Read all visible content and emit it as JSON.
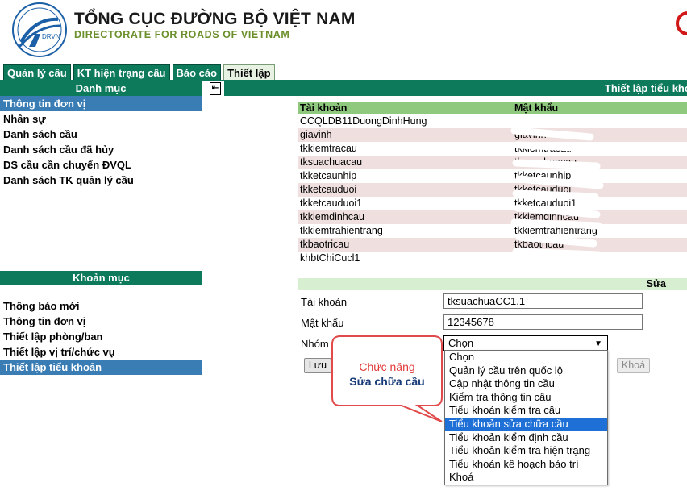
{
  "header": {
    "title_vi": "TỔNG CỤC ĐƯỜNG BỘ VIỆT NAM",
    "title_en": "DIRECTORATE FOR ROADS OF VIETNAM",
    "logo_text": "DRVN"
  },
  "tabs": [
    {
      "label": "Quản lý cầu",
      "active": false
    },
    {
      "label": "KT hiện trạng cầu",
      "active": false
    },
    {
      "label": "Báo cáo",
      "active": false
    },
    {
      "label": "Thiết lập",
      "active": true
    }
  ],
  "sidebar": {
    "section1": {
      "title": "Danh mục",
      "items": [
        {
          "label": "Thông tin đơn vị",
          "selected": true
        },
        {
          "label": "Nhân sự",
          "selected": false
        },
        {
          "label": "Danh sách cầu",
          "selected": false
        },
        {
          "label": "Danh sách cầu đã hủy",
          "selected": false
        },
        {
          "label": "DS cầu cần chuyển ĐVQL",
          "selected": false
        },
        {
          "label": "Danh sách TK quản lý cầu",
          "selected": false
        }
      ]
    },
    "section2": {
      "title": "Khoản mục",
      "items": [
        {
          "label": "Thông báo mới",
          "selected": false
        },
        {
          "label": "Thông tin đơn vị",
          "selected": false
        },
        {
          "label": "Thiết lập phòng/ban",
          "selected": false
        },
        {
          "label": "Thiết lập vị trí/chức vụ",
          "selected": false
        },
        {
          "label": "Thiết lập tiểu khoản",
          "selected": true
        }
      ]
    }
  },
  "main": {
    "header_title": "Thiết lập tiểu khoản",
    "table": {
      "columns": [
        "Tài khoản",
        "Mật khẩu"
      ],
      "rows": [
        {
          "account": "CCQLDB11DuongDinhHung",
          "password": ""
        },
        {
          "account": "giavinh",
          "password": "giavinh"
        },
        {
          "account": "tkkiemtracau",
          "password": "tkkiemtracau"
        },
        {
          "account": "tksuachuacau",
          "password": "tksuachuacau"
        },
        {
          "account": "tkketcaunhip",
          "password": "tkketcaunhip"
        },
        {
          "account": "tkketcauduoi",
          "password": "tkketcauduoi"
        },
        {
          "account": "tkketcauduoi1",
          "password": "tkketcauduoi1"
        },
        {
          "account": "tkkiemdinhcau",
          "password": "tkkiemdinhcau"
        },
        {
          "account": "tkkiemtrahientrang",
          "password": "tkkiemtrahientrang"
        },
        {
          "account": "tkbaotricau",
          "password": "tkbaotricau"
        },
        {
          "account": "khbtChiCucl1",
          "password": ""
        }
      ]
    },
    "edit": {
      "header": "Sửa",
      "account_label": "Tài khoản",
      "account_value": "tksuachuaCC1.1",
      "password_label": "Mật khẩu",
      "password_value": "12345678",
      "group_label": "Nhóm",
      "group_selected": "Chọn",
      "group_options": [
        {
          "label": "Chọn",
          "highlighted": false
        },
        {
          "label": "Quản lý cầu trên quốc lộ",
          "highlighted": false
        },
        {
          "label": "Cập nhật thông tin cầu",
          "highlighted": false
        },
        {
          "label": "Kiểm tra thông tin cầu",
          "highlighted": false
        },
        {
          "label": "Tiểu khoản kiểm tra cầu",
          "highlighted": false
        },
        {
          "label": "Tiểu khoản sửa chữa cầu",
          "highlighted": true
        },
        {
          "label": "Tiểu khoản kiểm định cầu",
          "highlighted": false
        },
        {
          "label": "Tiểu khoản kiểm tra hiện trạng",
          "highlighted": false
        },
        {
          "label": "Tiểu khoản kế hoạch bảo trì",
          "highlighted": false
        },
        {
          "label": "Khoá",
          "highlighted": false
        }
      ],
      "save_label": "Lưu",
      "lock_label": "Khoá"
    },
    "callout": {
      "line1": "Chức năng",
      "line2": "Sửa chữa cầu"
    }
  },
  "colors": {
    "primary_green": "#0d7a5c",
    "table_header": "#8ec97e",
    "row_alt": "#efdfdf",
    "sidebar_selected": "#3a7db5",
    "dropdown_highlight": "#1e6fd6",
    "callout_red": "#e03b3b"
  }
}
